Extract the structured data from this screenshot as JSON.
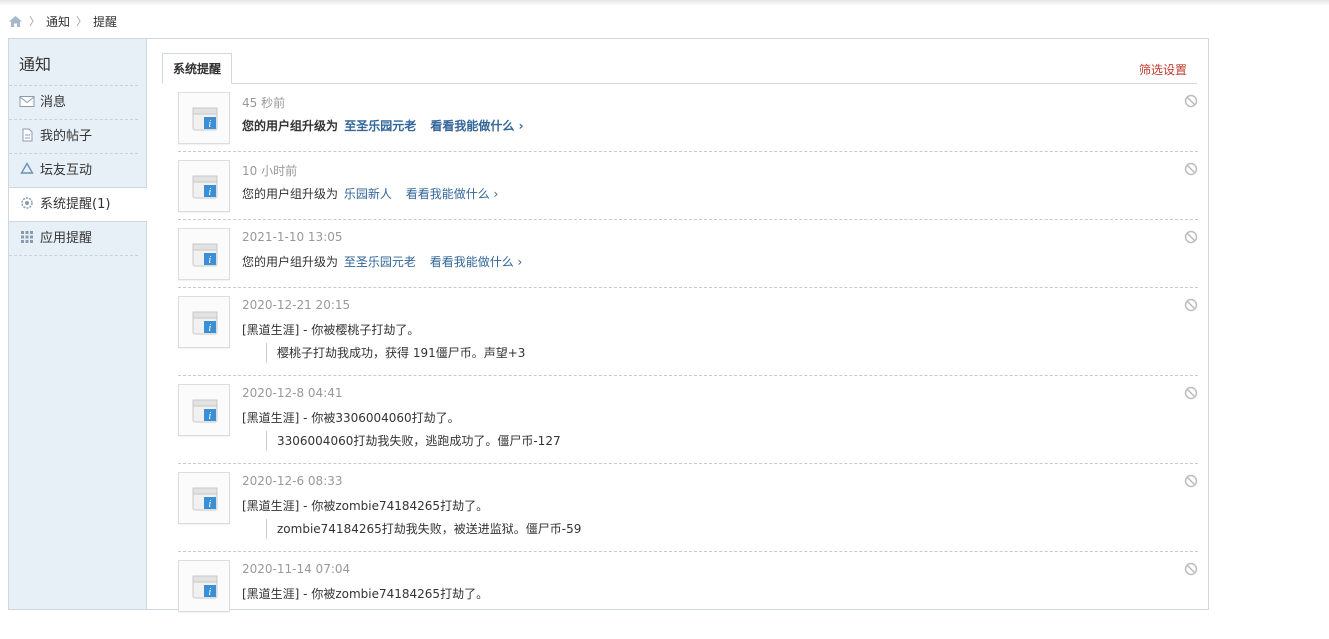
{
  "breadcrumb": {
    "home_icon": "home-icon",
    "items": [
      "通知",
      "提醒"
    ],
    "separator": "〉"
  },
  "sidebar": {
    "title": "通知",
    "items": [
      {
        "label": "消息",
        "icon": "envelope-icon"
      },
      {
        "label": "我的帖子",
        "icon": "document-icon"
      },
      {
        "label": "坛友互动",
        "icon": "recycle-icon"
      },
      {
        "label": "系统提醒(1)",
        "icon": "gear-icon",
        "active": true
      },
      {
        "label": "应用提醒",
        "icon": "grid-icon"
      }
    ]
  },
  "tabs": {
    "active_label": "系统提醒",
    "filter_label": "筛选设置"
  },
  "colors": {
    "accent_link": "#336699",
    "filter_link": "#c0392b",
    "sidebar_bg": "#e8f0f7"
  },
  "notices": [
    {
      "time": "45 秒前",
      "text": "您的用户组升级为",
      "group": "至圣乐园元老",
      "action": "看看我能做什么 ›",
      "bold": true
    },
    {
      "time": "10 小时前",
      "text": "您的用户组升级为",
      "group": "乐园新人",
      "action": "看看我能做什么 ›"
    },
    {
      "time": "2021-1-10 13:05",
      "text": "您的用户组升级为",
      "group": "至圣乐园元老",
      "action": "看看我能做什么 ›"
    },
    {
      "time": "2020-12-21 20:15",
      "text": "[黑道生涯] - 你被樱桃子打劫了。",
      "quote": "樱桃子打劫我成功，获得 191僵尸币。声望+3"
    },
    {
      "time": "2020-12-8 04:41",
      "text": "[黑道生涯] - 你被3306004060打劫了。",
      "quote": "3306004060打劫我失败，逃跑成功了。僵尸币-127"
    },
    {
      "time": "2020-12-6 08:33",
      "text": "[黑道生涯] - 你被zombie74184265打劫了。",
      "quote": "zombie74184265打劫我失败，被送进监狱。僵尸币-59"
    },
    {
      "time": "2020-11-14 07:04",
      "text": "[黑道生涯] - 你被zombie74184265打劫了。"
    }
  ]
}
